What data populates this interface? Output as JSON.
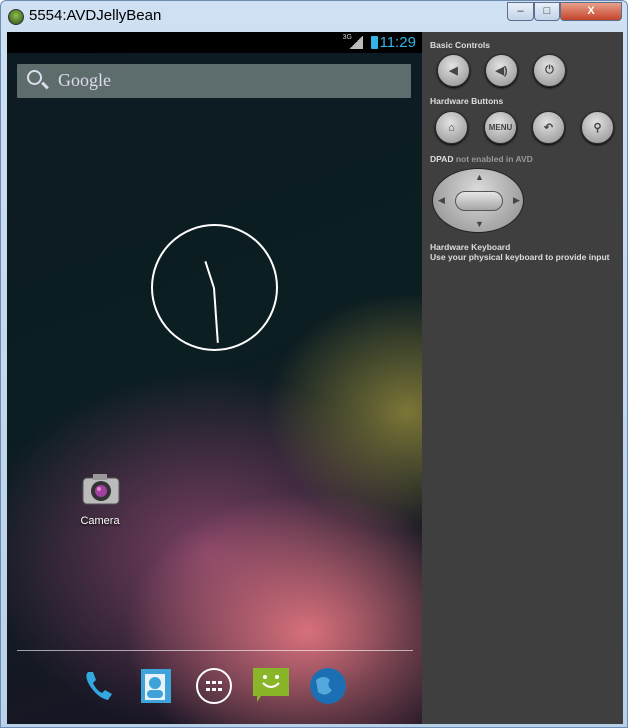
{
  "window": {
    "title": "5554:AVDJellyBean",
    "minimize": "–",
    "maximize": "□",
    "close": "X"
  },
  "phone": {
    "status": {
      "network": "3G",
      "time": "11:29"
    },
    "search": {
      "label": "Google"
    },
    "apps": [
      {
        "label": "Camera"
      }
    ],
    "dock": [
      "phone",
      "contacts",
      "all-apps",
      "messaging",
      "browser"
    ]
  },
  "controls": {
    "basic_controls_label": "Basic Controls",
    "hardware_buttons_label": "Hardware Buttons",
    "menu_label": "MENU",
    "dpad_label_bold": "DPAD",
    "dpad_label_rest": " not enabled in AVD",
    "keyboard_title": "Hardware Keyboard",
    "keyboard_desc": "Use your physical keyboard to provide input"
  }
}
